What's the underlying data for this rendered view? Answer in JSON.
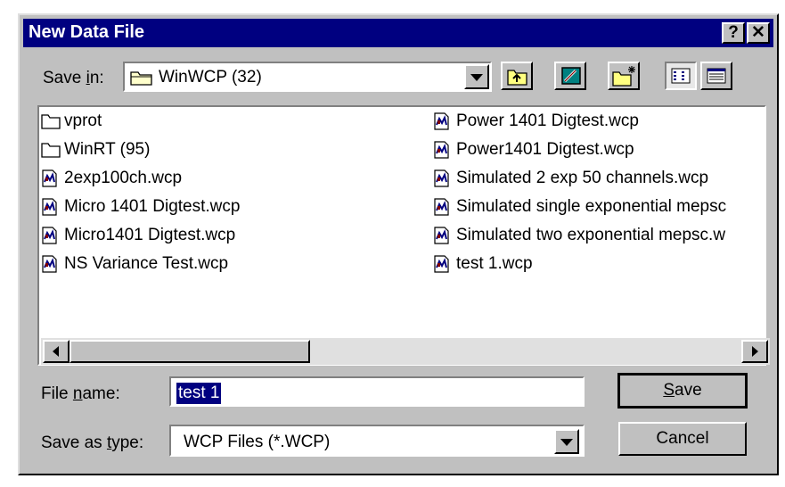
{
  "dialog": {
    "title": "New Data File",
    "help_button": "?",
    "close_button": "✕"
  },
  "save_in": {
    "label_prefix": "Save ",
    "label_underlined": "i",
    "label_suffix": "n:",
    "value": "WinWCP (32)"
  },
  "toolbar": {
    "up_icon": "up-folder-icon",
    "desktop_icon": "desktop-icon",
    "new_folder_icon": "new-folder-icon",
    "list_view_icon": "list-view-icon",
    "details_view_icon": "details-view-icon"
  },
  "files": [
    {
      "name": "vprot",
      "type": "folder"
    },
    {
      "name": "WinRT (95)",
      "type": "folder"
    },
    {
      "name": "2exp100ch.wcp",
      "type": "file"
    },
    {
      "name": "Micro 1401 Digtest.wcp",
      "type": "file"
    },
    {
      "name": "Micro1401 Digtest.wcp",
      "type": "file"
    },
    {
      "name": "NS Variance Test.wcp",
      "type": "file"
    },
    {
      "name": "Power 1401 Digtest.wcp",
      "type": "file"
    },
    {
      "name": "Power1401 Digtest.wcp",
      "type": "file"
    },
    {
      "name": "Simulated 2 exp 50 channels.wcp",
      "type": "file"
    },
    {
      "name": "Simulated single exponential mepsc",
      "type": "file"
    },
    {
      "name": "Simulated two exponential mepsc.w",
      "type": "file"
    },
    {
      "name": "test 1.wcp",
      "type": "file"
    }
  ],
  "file_name": {
    "label_prefix": "File ",
    "label_underlined": "n",
    "label_suffix": "ame:",
    "value": "test 1"
  },
  "save_as_type": {
    "label_prefix": "Save as ",
    "label_underlined": "t",
    "label_suffix": "ype:",
    "value": "WCP Files (*.WCP)"
  },
  "buttons": {
    "save_underlined": "S",
    "save_rest": "ave",
    "cancel": "Cancel"
  }
}
